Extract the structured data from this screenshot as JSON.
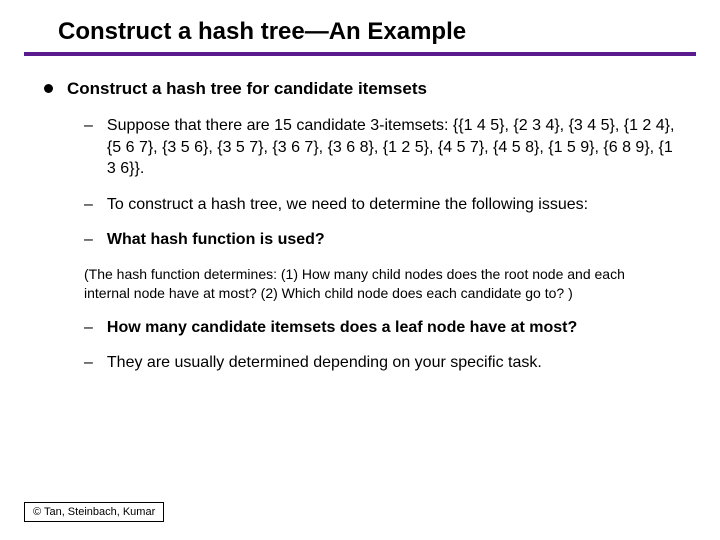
{
  "title": "Construct a hash tree—An Example",
  "main": {
    "heading": "Construct a hash tree for candidate itemsets",
    "items": [
      {
        "text": "Suppose that there are 15 candidate 3-itemsets: {{1 4 5}, {2 3 4}, {3 4 5}, {1 2 4}, {5 6 7}, {3 5 6}, {3 5 7}, {3 6 7}, {3 6 8}, {1 2 5}, {4 5 7}, {4 5 8}, {1 5 9}, {6 8 9}, {1 3 6}}.",
        "bold": false
      },
      {
        "text": "To construct a hash tree, we need to determine the following issues:",
        "bold": false
      },
      {
        "text": "What hash function is used?",
        "bold": true
      }
    ],
    "parenthetical": "(The hash function determines: (1) How many child nodes does the root node and each internal node have at most? (2) Which child node does each candidate go to? )",
    "items2": [
      {
        "text": "How many candidate itemsets does a leaf node have at most?",
        "bold": true
      },
      {
        "text": "They are usually determined depending on your specific task.",
        "bold": false
      }
    ]
  },
  "footer": "© Tan, Steinbach, Kumar"
}
